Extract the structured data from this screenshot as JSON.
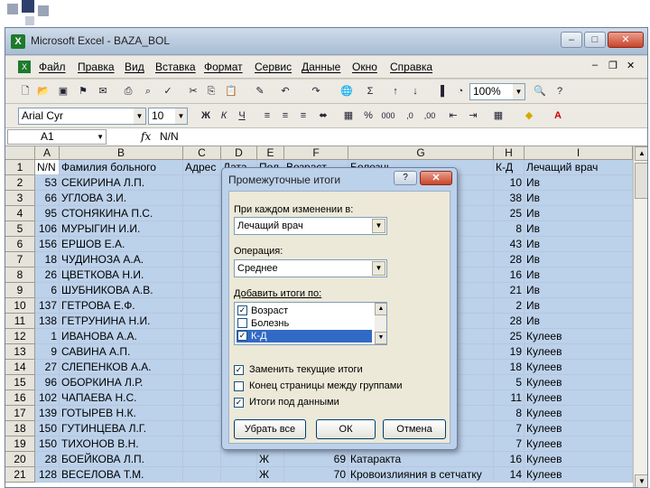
{
  "window": {
    "title": "Microsoft Excel - BAZA_BOL"
  },
  "menu": [
    "Файл",
    "Правка",
    "Вид",
    "Вставка",
    "Формат",
    "Сервис",
    "Данные",
    "Окно",
    "Справка"
  ],
  "toolbar": {
    "zoom": "100%",
    "font": "Arial Cyr",
    "size": "10"
  },
  "formula": {
    "cell": "A1",
    "value": "N/N"
  },
  "columns": [
    "A",
    "B",
    "C",
    "D",
    "E",
    "F",
    "G",
    "H",
    "I"
  ],
  "header_row": [
    "N/N",
    "Фамилия больного",
    "Адрес",
    "Дата",
    "Пол",
    "Возраст",
    "Болезнь",
    "К-Д",
    "Лечащий врач"
  ],
  "rows": [
    {
      "r": "2",
      "a": "53",
      "b": "СЕКИРИНА Л.П.",
      "e": "",
      "f": "",
      "g": "",
      "h": "10",
      "i": "Ив"
    },
    {
      "r": "3",
      "a": "66",
      "b": "УГЛОВА З.И.",
      "e": "",
      "f": "",
      "g": "",
      "h": "38",
      "i": "Ив"
    },
    {
      "r": "4",
      "a": "95",
      "b": "СТОНЯКИНА П.С.",
      "e": "",
      "f": "",
      "g": "",
      "h": "25",
      "i": "Ив"
    },
    {
      "r": "5",
      "a": "106",
      "b": "МУРЫГИН И.И.",
      "e": "",
      "f": "",
      "g": "",
      "h": "8",
      "i": "Ив"
    },
    {
      "r": "6",
      "a": "156",
      "b": "ЕРШОВ Е.А.",
      "e": "",
      "f": "",
      "g": "",
      "h": "43",
      "i": "Ив"
    },
    {
      "r": "7",
      "a": "18",
      "b": "ЧУДИНОЗА А.А.",
      "e": "",
      "f": "",
      "g": "",
      "h": "28",
      "i": "Ив"
    },
    {
      "r": "8",
      "a": "26",
      "b": "ЦВЕТКОВА Н.И.",
      "e": "",
      "f": "",
      "g": "",
      "h": "16",
      "i": "Ив"
    },
    {
      "r": "9",
      "a": "6",
      "b": "ШУБНИКОВА А.В.",
      "e": "",
      "f": "",
      "g": "атку",
      "h": "21",
      "i": "Ив"
    },
    {
      "r": "10",
      "a": "137",
      "b": "ГЕТРОВА Е.Ф.",
      "e": "",
      "f": "",
      "g": "атку",
      "h": "2",
      "i": "Ив"
    },
    {
      "r": "11",
      "a": "138",
      "b": "ГЕТРУНИНА Н.И.",
      "e": "",
      "f": "",
      "g": "",
      "h": "28",
      "i": "Ив"
    },
    {
      "r": "12",
      "a": "1",
      "b": "ИВАНОВА А.А.",
      "e": "",
      "f": "",
      "g": "",
      "h": "25",
      "i": "Кулеев"
    },
    {
      "r": "13",
      "a": "9",
      "b": "САВИНА А.П.",
      "e": "",
      "f": "",
      "g": "",
      "h": "19",
      "i": "Кулеев"
    },
    {
      "r": "14",
      "a": "27",
      "b": "СЛЕПЕНКОВ А.А.",
      "e": "",
      "f": "",
      "g": "",
      "h": "18",
      "i": "Кулеев"
    },
    {
      "r": "15",
      "a": "96",
      "b": "ОБОРКИНА Л.Р.",
      "e": "",
      "f": "",
      "g": "",
      "h": "5",
      "i": "Кулеев"
    },
    {
      "r": "16",
      "a": "102",
      "b": "ЧАПАЕВА Н.С.",
      "e": "",
      "f": "",
      "g": "",
      "h": "11",
      "i": "Кулеев"
    },
    {
      "r": "17",
      "a": "139",
      "b": "ГОТЫРЕВ Н.К.",
      "e": "",
      "f": "",
      "g": "",
      "h": "8",
      "i": "Кулеев"
    },
    {
      "r": "18",
      "a": "150",
      "b": "ГУТИНЦЕВА Л.Г.",
      "e": "",
      "f": "",
      "g": "",
      "h": "7",
      "i": "Кулеев"
    },
    {
      "r": "19",
      "a": "150",
      "b": "ТИХОНОВ В.Н.",
      "e": "М",
      "f": "68",
      "g": "Глаукома",
      "h": "7",
      "i": "Кулеев"
    },
    {
      "r": "20",
      "a": "28",
      "b": "БОЕЙКОВА Л.П.",
      "e": "Ж",
      "f": "69",
      "g": "Катаракта",
      "h": "16",
      "i": "Кулеев"
    },
    {
      "r": "21",
      "a": "128",
      "b": "ВЕСЕЛОВА Т.М.",
      "e": "Ж",
      "f": "70",
      "g": "Кровоизлияния в сетчатку",
      "h": "14",
      "i": "Кулеев"
    }
  ],
  "dialog": {
    "title": "Промежуточные итоги",
    "help": "?",
    "close": "✕",
    "change_label": "При каждом изменении в:",
    "change_value": "Лечащий врач",
    "op_label": "Операция:",
    "op_value": "Среднее",
    "add_label": "Добавить итоги по:",
    "list": [
      {
        "label": "Возраст",
        "checked": true
      },
      {
        "label": "Болезнь",
        "checked": false
      },
      {
        "label": "К-Д",
        "checked": true
      }
    ],
    "replace": "Заменить текущие итоги",
    "pagebreak": "Конец страницы между группами",
    "below": "Итоги под данными",
    "remove_btn": "Убрать все",
    "ok_btn": "ОК",
    "cancel_btn": "Отмена"
  }
}
